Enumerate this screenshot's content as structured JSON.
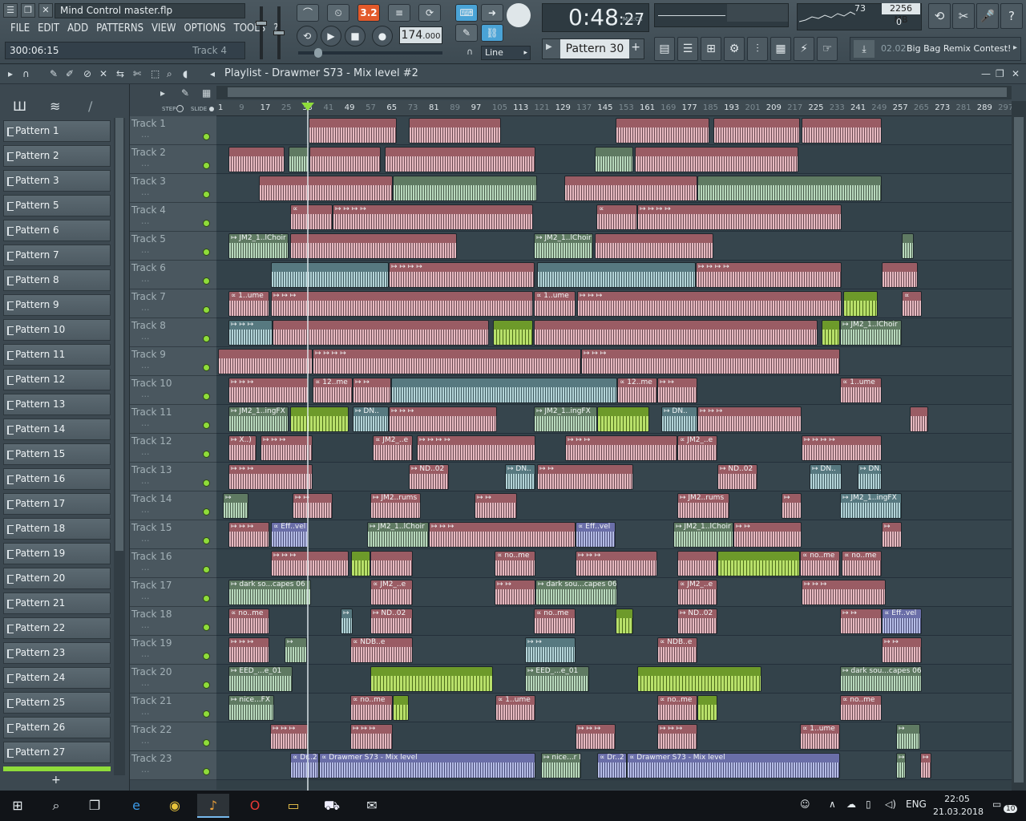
{
  "app": {
    "filename": "Mind Control master.flp",
    "menu": [
      "FILE",
      "EDIT",
      "ADD",
      "PATTERNS",
      "VIEW",
      "OPTIONS",
      "TOOLS",
      "?"
    ],
    "song_position": "300:06:15",
    "hint": "Track 4"
  },
  "transport": {
    "tempo": "174",
    "tempo_dec": ".000",
    "time_main": "0:48",
    "time_sub": "27",
    "time_label": "M:S:CS",
    "pattern_mode": "3.2",
    "snap": "Line",
    "pattern": "Pattern 30"
  },
  "monitor": {
    "cpu": "73",
    "ram": "2256 MB",
    "voices": "0"
  },
  "news": {
    "date": "02.02",
    "text": "Big Bag Remix Contest!"
  },
  "playlist": {
    "title": "Playlist - Drawmer S73 - Mix level #2",
    "step_label": "STEP",
    "slide_label": "SLIDE"
  },
  "ruler": [
    "1",
    "9",
    "17",
    "25",
    "33",
    "41",
    "49",
    "57",
    "65",
    "73",
    "81",
    "89",
    "97",
    "105",
    "113",
    "121",
    "129",
    "137",
    "145",
    "153",
    "161",
    "169",
    "177",
    "185",
    "193",
    "201",
    "209",
    "217",
    "225",
    "233",
    "241",
    "249",
    "257",
    "265",
    "273",
    "281",
    "289",
    "297",
    "305"
  ],
  "patterns": [
    "Pattern 1",
    "Pattern 2",
    "Pattern 3",
    "Pattern 5",
    "Pattern 6",
    "Pattern 7",
    "Pattern 8",
    "Pattern 9",
    "Pattern 10",
    "Pattern 11",
    "Pattern 12",
    "Pattern 13",
    "Pattern 14",
    "Pattern 15",
    "Pattern 16",
    "Pattern 17",
    "Pattern 18",
    "Pattern 19",
    "Pattern 20",
    "Pattern 21",
    "Pattern 22",
    "Pattern 23",
    "Pattern 24",
    "Pattern 25",
    "Pattern 26",
    "Pattern 27"
  ],
  "tracks": [
    "Track 1",
    "Track 2",
    "Track 3",
    "Track 4",
    "Track 5",
    "Track 6",
    "Track 7",
    "Track 8",
    "Track 9",
    "Track 10",
    "Track 11",
    "Track 12",
    "Track 13",
    "Track 14",
    "Track 15",
    "Track 16",
    "Track 17",
    "Track 18",
    "Track 19",
    "Track 20",
    "Track 21",
    "Track 22",
    "Track 23"
  ],
  "clips": [
    {
      "t": 0,
      "s": 115,
      "e": 225,
      "c": "pink",
      "n": ""
    },
    {
      "t": 0,
      "s": 240,
      "e": 355,
      "c": "pink",
      "n": ""
    },
    {
      "t": 0,
      "s": 498,
      "e": 615,
      "c": "pink",
      "n": ""
    },
    {
      "t": 0,
      "s": 620,
      "e": 728,
      "c": "pink",
      "n": ""
    },
    {
      "t": 0,
      "s": 730,
      "e": 830,
      "c": "pink",
      "n": ""
    },
    {
      "t": 1,
      "s": 15,
      "e": 85,
      "c": "pink",
      "n": ""
    },
    {
      "t": 1,
      "s": 90,
      "e": 115,
      "c": "green",
      "n": ""
    },
    {
      "t": 1,
      "s": 116,
      "e": 205,
      "c": "pink",
      "n": ""
    },
    {
      "t": 1,
      "s": 210,
      "e": 398,
      "c": "pink",
      "n": ""
    },
    {
      "t": 1,
      "s": 472,
      "e": 520,
      "c": "green",
      "n": ""
    },
    {
      "t": 1,
      "s": 522,
      "e": 726,
      "c": "pink",
      "n": ""
    },
    {
      "t": 2,
      "s": 53,
      "e": 220,
      "c": "pink",
      "n": ""
    },
    {
      "t": 2,
      "s": 220,
      "e": 400,
      "c": "green",
      "n": ""
    },
    {
      "t": 2,
      "s": 434,
      "e": 600,
      "c": "pink",
      "n": ""
    },
    {
      "t": 2,
      "s": 600,
      "e": 830,
      "c": "green",
      "n": ""
    },
    {
      "t": 3,
      "s": 92,
      "e": 145,
      "c": "pink",
      "n": "∝"
    },
    {
      "t": 3,
      "s": 145,
      "e": 395,
      "c": "pink",
      "n": "↦ ↦ ↦ ↦"
    },
    {
      "t": 3,
      "s": 474,
      "e": 525,
      "c": "pink",
      "n": "∝"
    },
    {
      "t": 3,
      "s": 525,
      "e": 780,
      "c": "pink",
      "n": "↦ ↦ ↦ ↦"
    },
    {
      "t": 4,
      "s": 15,
      "e": 90,
      "c": "green",
      "n": "↦ JM2_1..lChoir"
    },
    {
      "t": 4,
      "s": 92,
      "e": 300,
      "c": "pink",
      "n": ""
    },
    {
      "t": 4,
      "s": 396,
      "e": 470,
      "c": "green",
      "n": "↦ JM2_1..lChoir"
    },
    {
      "t": 4,
      "s": 472,
      "e": 620,
      "c": "pink",
      "n": ""
    },
    {
      "t": 4,
      "s": 855,
      "e": 870,
      "c": "green",
      "n": ""
    },
    {
      "t": 5,
      "s": 68,
      "e": 215,
      "c": "teal",
      "n": ""
    },
    {
      "t": 5,
      "s": 215,
      "e": 397,
      "c": "pink",
      "n": "↦ ↦ ↦ ↦"
    },
    {
      "t": 5,
      "s": 400,
      "e": 598,
      "c": "teal",
      "n": ""
    },
    {
      "t": 5,
      "s": 598,
      "e": 780,
      "c": "pink",
      "n": "↦ ↦ ↦ ↦"
    },
    {
      "t": 5,
      "s": 830,
      "e": 875,
      "c": "pink",
      "n": ""
    },
    {
      "t": 6,
      "s": 15,
      "e": 66,
      "c": "pink",
      "n": "∝ 1..ume"
    },
    {
      "t": 6,
      "s": 68,
      "e": 395,
      "c": "pink",
      "n": "↦ ↦ ↦"
    },
    {
      "t": 6,
      "s": 396,
      "e": 448,
      "c": "pink",
      "n": "∝ 1..ume"
    },
    {
      "t": 6,
      "s": 450,
      "e": 780,
      "c": "pink",
      "n": "↦ ↦ ↦"
    },
    {
      "t": 6,
      "s": 782,
      "e": 825,
      "c": "lime",
      "n": ""
    },
    {
      "t": 6,
      "s": 855,
      "e": 880,
      "c": "pink",
      "n": "∝"
    },
    {
      "t": 7,
      "s": 15,
      "e": 70,
      "c": "teal",
      "n": "↦ ↦ ↦"
    },
    {
      "t": 7,
      "s": 70,
      "e": 340,
      "c": "pink",
      "n": ""
    },
    {
      "t": 7,
      "s": 345,
      "e": 395,
      "c": "lime",
      "n": ""
    },
    {
      "t": 7,
      "s": 396,
      "e": 750,
      "c": "pink",
      "n": ""
    },
    {
      "t": 7,
      "s": 755,
      "e": 778,
      "c": "lime",
      "n": ""
    },
    {
      "t": 7,
      "s": 778,
      "e": 855,
      "c": "green",
      "n": "↦ JM2_1..lChoir"
    },
    {
      "t": 8,
      "s": 2,
      "e": 120,
      "c": "pink",
      "n": ""
    },
    {
      "t": 8,
      "s": 120,
      "e": 455,
      "c": "pink",
      "n": "↦ ↦ ↦ ↦"
    },
    {
      "t": 8,
      "s": 455,
      "e": 778,
      "c": "pink",
      "n": "↦ ↦ ↦"
    },
    {
      "t": 9,
      "s": 15,
      "e": 115,
      "c": "pink",
      "n": "↦ ↦ ↦"
    },
    {
      "t": 9,
      "s": 120,
      "e": 170,
      "c": "pink",
      "n": "∝ 12..me"
    },
    {
      "t": 9,
      "s": 170,
      "e": 218,
      "c": "pink",
      "n": "↦ ↦"
    },
    {
      "t": 9,
      "s": 218,
      "e": 500,
      "c": "teal",
      "n": ""
    },
    {
      "t": 9,
      "s": 500,
      "e": 550,
      "c": "pink",
      "n": "∝ 12..me"
    },
    {
      "t": 9,
      "s": 550,
      "e": 600,
      "c": "pink",
      "n": "↦ ↦"
    },
    {
      "t": 9,
      "s": 778,
      "e": 830,
      "c": "pink",
      "n": "∝ 1..ume"
    },
    {
      "t": 10,
      "s": 15,
      "e": 90,
      "c": "green",
      "n": "↦ JM2_1..ingFX"
    },
    {
      "t": 10,
      "s": 92,
      "e": 165,
      "c": "lime",
      "n": ""
    },
    {
      "t": 10,
      "s": 170,
      "e": 215,
      "c": "teal",
      "n": "↦ DN.."
    },
    {
      "t": 10,
      "s": 215,
      "e": 350,
      "c": "pink",
      "n": "↦ ↦ ↦"
    },
    {
      "t": 10,
      "s": 396,
      "e": 475,
      "c": "green",
      "n": "↦ JM2_1..ingFX"
    },
    {
      "t": 10,
      "s": 475,
      "e": 540,
      "c": "lime",
      "n": ""
    },
    {
      "t": 10,
      "s": 555,
      "e": 600,
      "c": "teal",
      "n": "↦ DN.."
    },
    {
      "t": 10,
      "s": 600,
      "e": 730,
      "c": "pink",
      "n": "↦ ↦ ↦"
    },
    {
      "t": 10,
      "s": 865,
      "e": 888,
      "c": "pink",
      "n": ""
    },
    {
      "t": 11,
      "s": 15,
      "e": 50,
      "c": "pink",
      "n": "↦ X..)"
    },
    {
      "t": 11,
      "s": 55,
      "e": 120,
      "c": "pink",
      "n": "↦ ↦ ↦"
    },
    {
      "t": 11,
      "s": 195,
      "e": 245,
      "c": "pink",
      "n": "∝ JM2_..e"
    },
    {
      "t": 11,
      "s": 250,
      "e": 398,
      "c": "pink",
      "n": "↦ ↦ ↦ ↦"
    },
    {
      "t": 11,
      "s": 435,
      "e": 575,
      "c": "pink",
      "n": "↦ ↦ ↦"
    },
    {
      "t": 11,
      "s": 575,
      "e": 625,
      "c": "pink",
      "n": "∝ JM2_..e"
    },
    {
      "t": 11,
      "s": 730,
      "e": 830,
      "c": "pink",
      "n": "↦ ↦ ↦ ↦"
    },
    {
      "t": 12,
      "s": 15,
      "e": 120,
      "c": "pink",
      "n": "↦ ↦ ↦"
    },
    {
      "t": 12,
      "s": 240,
      "e": 290,
      "c": "pink",
      "n": "↦ ND..02"
    },
    {
      "t": 12,
      "s": 360,
      "e": 398,
      "c": "teal",
      "n": "↦ DN.."
    },
    {
      "t": 12,
      "s": 400,
      "e": 520,
      "c": "pink",
      "n": "↦ ↦"
    },
    {
      "t": 12,
      "s": 625,
      "e": 675,
      "c": "pink",
      "n": "↦ ND..02"
    },
    {
      "t": 12,
      "s": 740,
      "e": 780,
      "c": "teal",
      "n": "↦ DN.."
    },
    {
      "t": 12,
      "s": 800,
      "e": 830,
      "c": "teal",
      "n": "↦ DN.."
    },
    {
      "t": 13,
      "s": 8,
      "e": 40,
      "c": "green",
      "n": "↦"
    },
    {
      "t": 13,
      "s": 95,
      "e": 145,
      "c": "pink",
      "n": "↦ ↦"
    },
    {
      "t": 13,
      "s": 192,
      "e": 255,
      "c": "pink",
      "n": "↦ JM2..rums"
    },
    {
      "t": 13,
      "s": 322,
      "e": 375,
      "c": "pink",
      "n": "↦ ↦"
    },
    {
      "t": 13,
      "s": 575,
      "e": 640,
      "c": "pink",
      "n": "↦ JM2..rums"
    },
    {
      "t": 13,
      "s": 705,
      "e": 730,
      "c": "pink",
      "n": "↦"
    },
    {
      "t": 13,
      "s": 778,
      "e": 855,
      "c": "teal",
      "n": "↦ JM2_1..ingFX"
    },
    {
      "t": 14,
      "s": 15,
      "e": 66,
      "c": "pink",
      "n": "↦ ↦ ↦"
    },
    {
      "t": 14,
      "s": 68,
      "e": 115,
      "c": "blue",
      "n": "∝ Eff..vel"
    },
    {
      "t": 14,
      "s": 188,
      "e": 265,
      "c": "green",
      "n": "↦ JM2_1..lChoir"
    },
    {
      "t": 14,
      "s": 265,
      "e": 448,
      "c": "pink",
      "n": "↦ ↦ ↦"
    },
    {
      "t": 14,
      "s": 448,
      "e": 498,
      "c": "blue",
      "n": "∝ Eff..vel"
    },
    {
      "t": 14,
      "s": 570,
      "e": 645,
      "c": "green",
      "n": "↦ JM2_1..lChoir"
    },
    {
      "t": 14,
      "s": 645,
      "e": 730,
      "c": "pink",
      "n": "↦ ↦"
    },
    {
      "t": 14,
      "s": 830,
      "e": 855,
      "c": "pink",
      "n": "↦"
    },
    {
      "t": 15,
      "s": 68,
      "e": 165,
      "c": "pink",
      "n": "↦ ↦ ↦"
    },
    {
      "t": 15,
      "s": 168,
      "e": 192,
      "c": "lime",
      "n": ""
    },
    {
      "t": 15,
      "s": 192,
      "e": 245,
      "c": "pink",
      "n": ""
    },
    {
      "t": 15,
      "s": 347,
      "e": 398,
      "c": "pink",
      "n": "∝ no..me"
    },
    {
      "t": 15,
      "s": 448,
      "e": 550,
      "c": "pink",
      "n": "↦ ↦ ↦"
    },
    {
      "t": 15,
      "s": 575,
      "e": 625,
      "c": "pink",
      "n": ""
    },
    {
      "t": 15,
      "s": 625,
      "e": 728,
      "c": "lime",
      "n": ""
    },
    {
      "t": 15,
      "s": 728,
      "e": 778,
      "c": "pink",
      "n": "∝ no..me"
    },
    {
      "t": 15,
      "s": 780,
      "e": 830,
      "c": "pink",
      "n": "∝ no..me"
    },
    {
      "t": 16,
      "s": 15,
      "e": 118,
      "c": "green",
      "n": "↦ dark so...capes 06"
    },
    {
      "t": 16,
      "s": 192,
      "e": 245,
      "c": "pink",
      "n": "∝ JM2_..e"
    },
    {
      "t": 16,
      "s": 347,
      "e": 398,
      "c": "pink",
      "n": "↦ ↦"
    },
    {
      "t": 16,
      "s": 398,
      "e": 500,
      "c": "green",
      "n": "↦ dark sou...capes 06"
    },
    {
      "t": 16,
      "s": 575,
      "e": 625,
      "c": "pink",
      "n": "∝ JM2_..e"
    },
    {
      "t": 16,
      "s": 730,
      "e": 835,
      "c": "pink",
      "n": "↦ ↦ ↦"
    },
    {
      "t": 17,
      "s": 15,
      "e": 66,
      "c": "pink",
      "n": "∝ no..me"
    },
    {
      "t": 17,
      "s": 155,
      "e": 170,
      "c": "teal",
      "n": "↦"
    },
    {
      "t": 17,
      "s": 192,
      "e": 245,
      "c": "pink",
      "n": "↦ ND..02"
    },
    {
      "t": 17,
      "s": 396,
      "e": 448,
      "c": "pink",
      "n": "∝ no..me"
    },
    {
      "t": 17,
      "s": 498,
      "e": 520,
      "c": "lime",
      "n": ""
    },
    {
      "t": 17,
      "s": 575,
      "e": 625,
      "c": "pink",
      "n": "↦ ND..02"
    },
    {
      "t": 17,
      "s": 778,
      "e": 830,
      "c": "pink",
      "n": "↦ ↦"
    },
    {
      "t": 17,
      "s": 830,
      "e": 880,
      "c": "blue",
      "n": "∝ Eff..vel"
    },
    {
      "t": 18,
      "s": 15,
      "e": 66,
      "c": "pink",
      "n": "↦ ↦ ↦"
    },
    {
      "t": 18,
      "s": 85,
      "e": 113,
      "c": "green",
      "n": "↦"
    },
    {
      "t": 18,
      "s": 167,
      "e": 245,
      "c": "pink",
      "n": "∝ NDB..e"
    },
    {
      "t": 18,
      "s": 385,
      "e": 448,
      "c": "teal",
      "n": "↦ ↦"
    },
    {
      "t": 18,
      "s": 550,
      "e": 600,
      "c": "pink",
      "n": "∝ NDB..e"
    },
    {
      "t": 18,
      "s": 830,
      "e": 880,
      "c": "pink",
      "n": "↦ ↦"
    },
    {
      "t": 19,
      "s": 15,
      "e": 95,
      "c": "green",
      "n": "↦ EED_...e_01"
    },
    {
      "t": 19,
      "s": 192,
      "e": 345,
      "c": "lime",
      "n": ""
    },
    {
      "t": 19,
      "s": 385,
      "e": 465,
      "c": "green",
      "n": "↦ EED_...e_01"
    },
    {
      "t": 19,
      "s": 525,
      "e": 680,
      "c": "lime",
      "n": ""
    },
    {
      "t": 19,
      "s": 778,
      "e": 880,
      "c": "green",
      "n": "↦ dark sou...capes 06"
    },
    {
      "t": 20,
      "s": 15,
      "e": 72,
      "c": "green",
      "n": "↦ nice...FX"
    },
    {
      "t": 20,
      "s": 167,
      "e": 220,
      "c": "pink",
      "n": "∝ no..me"
    },
    {
      "t": 20,
      "s": 220,
      "e": 240,
      "c": "lime",
      "n": ""
    },
    {
      "t": 20,
      "s": 348,
      "e": 398,
      "c": "pink",
      "n": "∝ 1..ume"
    },
    {
      "t": 20,
      "s": 550,
      "e": 600,
      "c": "pink",
      "n": "∝ no..me"
    },
    {
      "t": 20,
      "s": 600,
      "e": 625,
      "c": "lime",
      "n": ""
    },
    {
      "t": 20,
      "s": 778,
      "e": 830,
      "c": "pink",
      "n": "∝ no..me"
    },
    {
      "t": 21,
      "s": 67,
      "e": 115,
      "c": "pink",
      "n": "↦ ↦ ↦"
    },
    {
      "t": 21,
      "s": 167,
      "e": 220,
      "c": "pink",
      "n": "↦ ↦ ↦"
    },
    {
      "t": 21,
      "s": 448,
      "e": 498,
      "c": "pink",
      "n": "↦ ↦ ↦"
    },
    {
      "t": 21,
      "s": 550,
      "e": 600,
      "c": "pink",
      "n": "↦ ↦ ↦"
    },
    {
      "t": 21,
      "s": 728,
      "e": 778,
      "c": "pink",
      "n": "∝ 1..ume"
    },
    {
      "t": 21,
      "s": 848,
      "e": 878,
      "c": "green",
      "n": "↦"
    },
    {
      "t": 22,
      "s": 92,
      "e": 128,
      "c": "blue",
      "n": "∝ Dr..2"
    },
    {
      "t": 22,
      "s": 128,
      "e": 398,
      "c": "blue",
      "n": "∝ Drawmer S73 - Mix level"
    },
    {
      "t": 22,
      "s": 405,
      "e": 455,
      "c": "green",
      "n": "↦ nice...r FX"
    },
    {
      "t": 22,
      "s": 475,
      "e": 512,
      "c": "blue",
      "n": "∝ Dr..2"
    },
    {
      "t": 22,
      "s": 512,
      "e": 778,
      "c": "blue",
      "n": "∝ Drawmer S73 - Mix level"
    },
    {
      "t": 22,
      "s": 848,
      "e": 860,
      "c": "green",
      "n": "↦"
    },
    {
      "t": 22,
      "s": 878,
      "e": 892,
      "c": "pink",
      "n": "↦"
    }
  ],
  "taskbar": {
    "lang": "ENG",
    "time": "22:05",
    "date": "21.03.2018",
    "notifications": "10"
  }
}
